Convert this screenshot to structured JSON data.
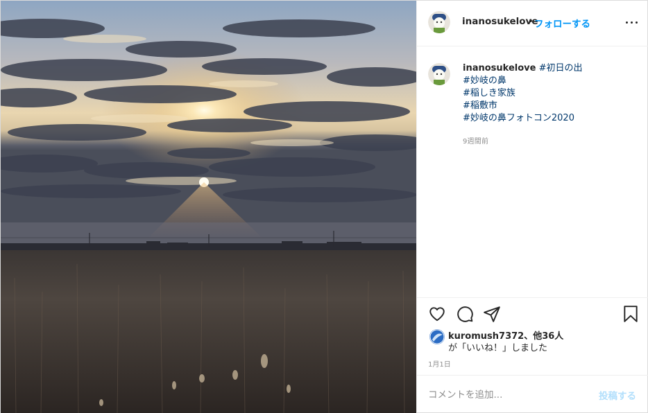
{
  "post": {
    "header": {
      "username": "inanosukelove",
      "separator": "•",
      "follow_label": "フォローする",
      "more_icon": "more-horizontal-icon"
    },
    "caption": {
      "username": "inanosukelove",
      "hashtags": [
        "#初日の出",
        "#妙岐の鼻",
        "#稲しき家族",
        "#稲敷市",
        "#妙岐の鼻フォトコン2020"
      ],
      "time_ago": "9週間前"
    },
    "actions": {
      "like_icon": "heart-icon",
      "comment_icon": "comment-icon",
      "share_icon": "paper-plane-icon",
      "save_icon": "bookmark-icon"
    },
    "likes": {
      "summary": "kuromush7372、他36人",
      "suffix": "が「いいね！」しました"
    },
    "date": "1月1日",
    "comment": {
      "placeholder": "コメントを追加...",
      "post_label": "投稿する"
    }
  },
  "colors": {
    "link_blue": "#0095f6",
    "hashtag": "#00376b",
    "muted": "#8e8e8e",
    "post_button_disabled": "#b2dffc"
  }
}
